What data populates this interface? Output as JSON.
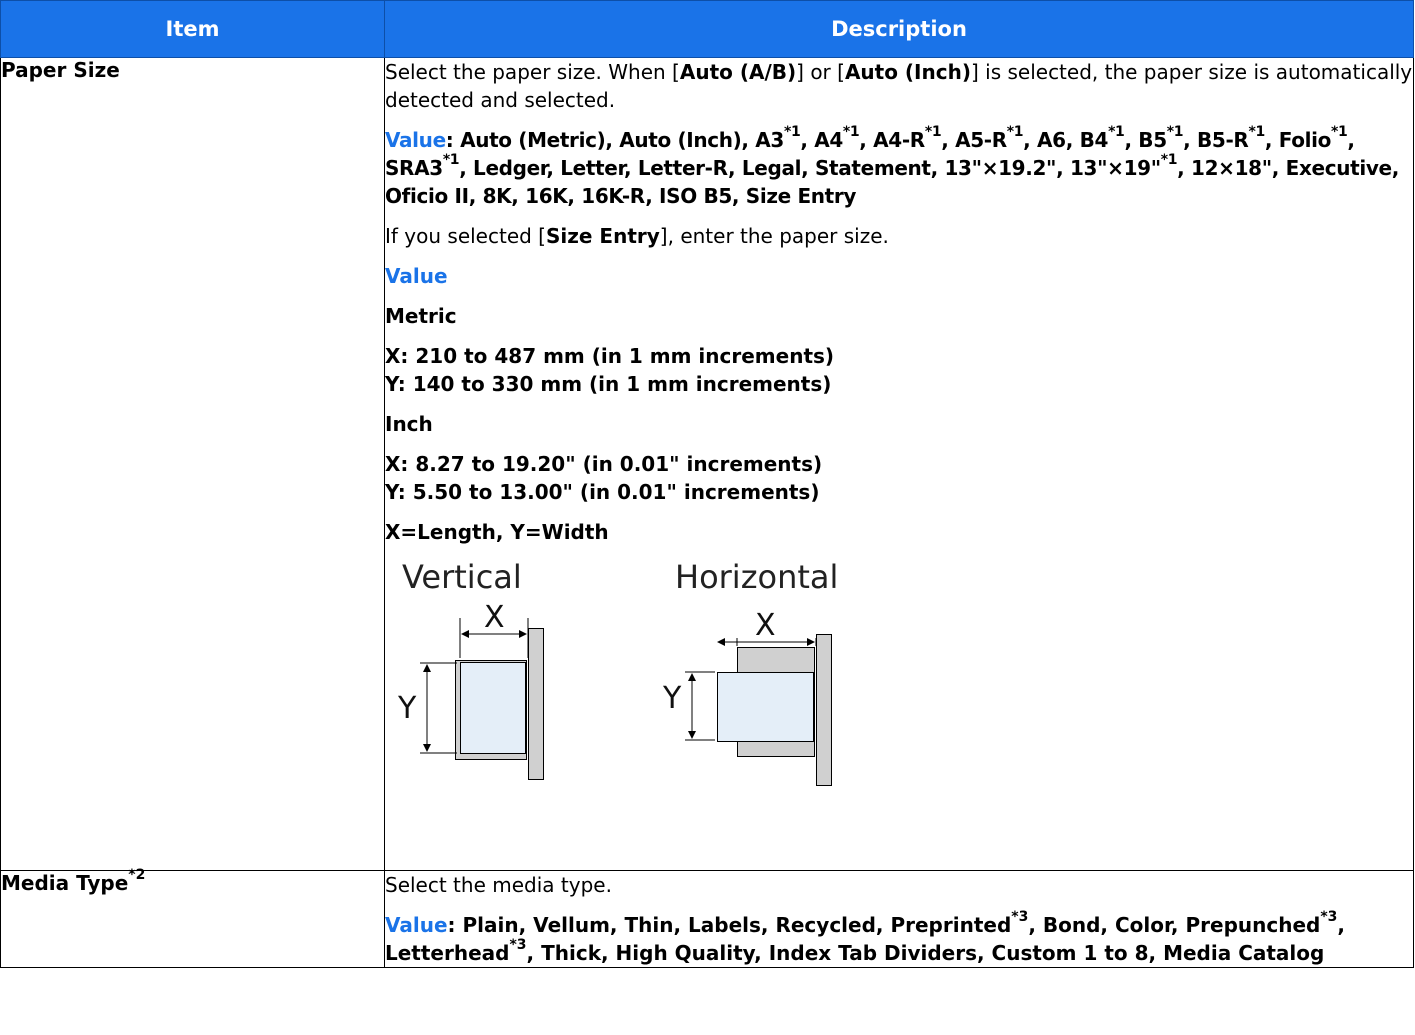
{
  "header": {
    "item": "Item",
    "description": "Description"
  },
  "rows": {
    "paper_size": {
      "label": "Paper Size",
      "intro": {
        "t1": "Select the paper size. When [",
        "b1": "Auto (A/B)",
        "t2": "] or [",
        "b2": "Auto (Inch)",
        "t3": "] is selected, the paper size is automatically detected and selected."
      },
      "value_label": "Value",
      "value_prefix": ": ",
      "values": {
        "v1": "Auto (Metric), Auto (Inch), A3",
        "s1": "*1",
        "v2": ", A4",
        "s2": "*1",
        "v3": ", A4-R",
        "s3": "*1",
        "v4": ", A5-R",
        "s4": "*1",
        "v5": ", A6, B4",
        "s5": "*1",
        "v6": ", B5",
        "s6": "*1",
        "v7": ", B5-R",
        "s7": "*1",
        "v8": ", Folio",
        "s8": "*1",
        "v9": ", SRA3",
        "s9": "*1",
        "v10": ", Ledger, Letter, Letter-R, Legal, Statement, 13\"×19.2\", 13\"×19\"",
        "s10": "*1",
        "v11": ", 12×18\", Executive, Oficio II, 8K, 16K, 16K-R, ISO B5, Size Entry"
      },
      "size_entry": {
        "t1": "If you selected [",
        "b1": "Size Entry",
        "t2": "], enter the paper size."
      },
      "value_heading": "Value",
      "metric": {
        "heading": "Metric",
        "x": "X: 210 to 487 mm (in 1 mm increments)",
        "y": "Y: 140 to 330 mm (in 1 mm increments)"
      },
      "inch": {
        "heading": "Inch",
        "x": "X: 8.27 to 19.20\" (in 0.01\" increments)",
        "y": "Y: 5.50 to 13.00\" (in 0.01\" increments)"
      },
      "xy_note": "X=Length, Y=Width",
      "diagram": {
        "vertical": "Vertical",
        "horizontal": "Horizontal",
        "x": "X",
        "y": "Y"
      }
    },
    "media_type": {
      "label": "Media Type",
      "label_sup": "*2",
      "intro": "Select the media type.",
      "value_label": "Value",
      "value_prefix": ": ",
      "values": {
        "v1": "Plain, Vellum, Thin, Labels, Recycled, Preprinted",
        "s1": "*3",
        "v2": ", Bond, Color, Prepunched",
        "s2": "*3",
        "v3": ", Letterhead",
        "s3": "*3",
        "v4": ", Thick, High Quality, Index Tab Dividers, Custom 1 to 8, Media Catalog"
      }
    }
  },
  "colors": {
    "header_bg": "#1a73e8",
    "accent": "#1a73e8",
    "paper_fill": "#e4eef8",
    "tray_fill": "#d0d0d0"
  }
}
